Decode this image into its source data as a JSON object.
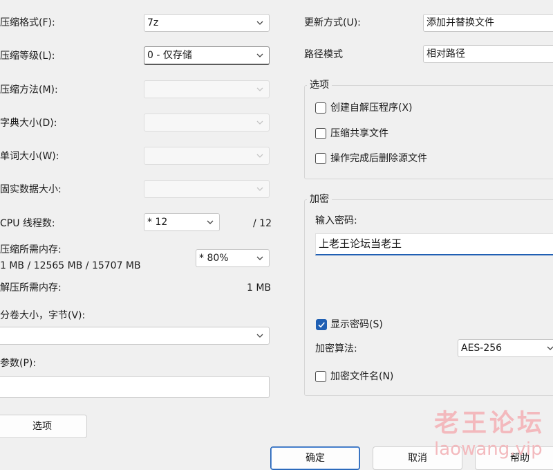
{
  "left": {
    "format_label": "压缩格式(F):",
    "format_value": "7z",
    "level_label": "压缩等级(L):",
    "level_value": "0 - 仅存储",
    "method_label": "压缩方法(M):",
    "dict_label": "字典大小(D):",
    "word_label": "单词大小(W):",
    "solid_label": "固实数据大小:",
    "threads_label": "CPU 线程数:",
    "threads_value": "* 12",
    "threads_max": "/ 12",
    "mem_compress_label": "压缩所需内存:",
    "mem_compress_info": "1 MB / 12565 MB / 15707 MB",
    "mem_percent_value": "* 80%",
    "mem_decompress_label": "解压所需内存:",
    "mem_decompress_value": "1 MB",
    "volume_label": "分卷大小，字节(V):",
    "params_label": "参数(P):",
    "options_button": "选项"
  },
  "right": {
    "update_label": "更新方式(U):",
    "update_value": "添加并替换文件",
    "path_label": "路径模式",
    "path_value": "相对路径",
    "options_group": "选项",
    "opt_sfx": "创建自解压程序(X)",
    "opt_shared": "压缩共享文件",
    "opt_delete": "操作完成后删除源文件",
    "enc_group": "加密",
    "pwd_label": "输入密码:",
    "pwd_value": "上老王论坛当老王",
    "show_pwd": "显示密码(S)",
    "enc_method_label": "加密算法:",
    "enc_method_value": "AES-256",
    "enc_names": "加密文件名(N)"
  },
  "buttons": {
    "ok": "确定",
    "cancel": "取消",
    "help": "帮助"
  },
  "watermark": {
    "line1": "老王论坛",
    "line2": "laowang.vip"
  }
}
